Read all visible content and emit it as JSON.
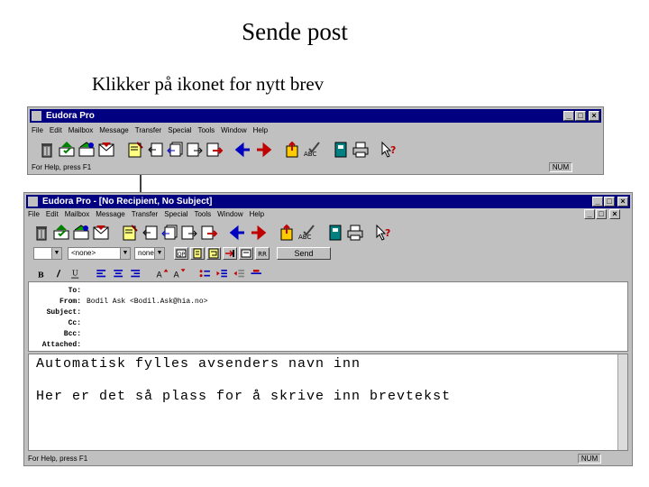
{
  "slide": {
    "title": "Sende post",
    "subtitle": "Klikker på ikonet for nytt brev"
  },
  "window1": {
    "title": "Eudora Pro",
    "menus": [
      "File",
      "Edit",
      "Mailbox",
      "Message",
      "Transfer",
      "Special",
      "Tools",
      "Window",
      "Help"
    ],
    "status_text": "For Help, press F1",
    "num_indicator": "NUM"
  },
  "window2": {
    "title": "Eudora Pro - [No Recipient, No Subject]",
    "menus": [
      "File",
      "Edit",
      "Mailbox",
      "Message",
      "Transfer",
      "Special",
      "Tools",
      "Window",
      "Help"
    ],
    "format": {
      "font_combo": "",
      "signature_combo": "<none>",
      "priority_combo": "none",
      "send_label": "Send"
    },
    "headers": [
      {
        "label": "To:",
        "value": ""
      },
      {
        "label": "From:",
        "value": "Bodil Ask <Bodil.Ask@hia.no>"
      },
      {
        "label": "Subject:",
        "value": ""
      },
      {
        "label": "Cc:",
        "value": ""
      },
      {
        "label": "Bcc:",
        "value": ""
      },
      {
        "label": "Attached:",
        "value": ""
      }
    ],
    "body_notes": {
      "line1": "Automatisk fylles avsenders navn inn",
      "line2": "Her er det så plass for å skrive inn brevtekst"
    },
    "status_text": "For Help, press F1",
    "num_indicator": "NUM"
  },
  "icons": {
    "main_toolbar": [
      "trash-icon",
      "check-mail-icon",
      "send-queued-icon",
      "in-mailbox-icon",
      "new-message-icon",
      "reply-icon",
      "reply-all-icon",
      "forward-icon",
      "redirect-icon",
      "prev-message-icon",
      "next-message-icon",
      "attach-file-icon",
      "check-spelling-icon",
      "address-book-icon",
      "print-icon",
      "help-icon"
    ],
    "format_toolbar": [
      "bold-icon",
      "italic-icon",
      "underline-icon",
      "align-left-icon",
      "align-center-icon",
      "align-right-icon",
      "font-size-up-icon",
      "font-size-down-icon",
      "bullet-list-icon",
      "indent-icon",
      "outdent-icon",
      "horizontal-rule-icon"
    ]
  },
  "colors": {
    "titlebar": "#000080",
    "chrome": "#c0c0c0"
  }
}
